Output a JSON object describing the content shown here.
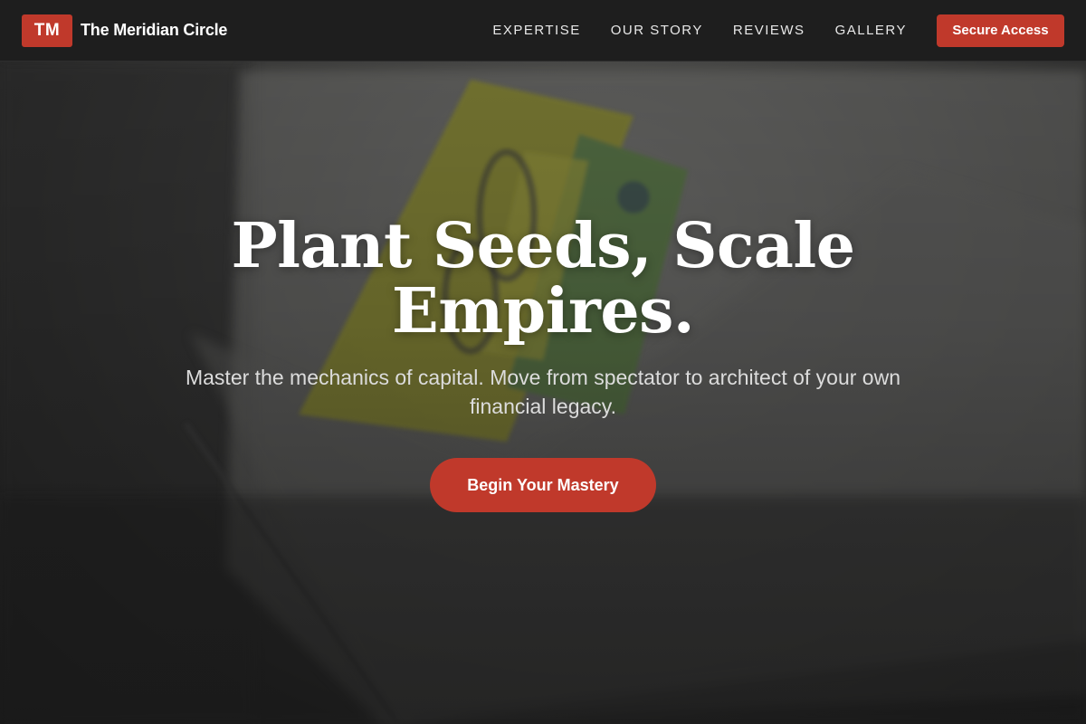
{
  "brand": {
    "logo_text": "TM",
    "name": "The Meridian Circle"
  },
  "nav": {
    "items": [
      {
        "label": "EXPERTISE"
      },
      {
        "label": "OUR STORY"
      },
      {
        "label": "REVIEWS"
      },
      {
        "label": "GALLERY"
      }
    ],
    "cta_label": "Secure Access"
  },
  "hero": {
    "title_line1": "Plant Seeds, Scale",
    "title_line2": "Empires.",
    "subtitle": "Master the mechanics of capital. Move from spectator to architect of your own financial legacy.",
    "cta_label": "Begin Your Mastery",
    "background_image": "cash-in-envelope-photo"
  },
  "colors": {
    "accent": "#c0392b",
    "header_bg": "#1e1e1e",
    "hero_text": "#ffffff",
    "subtitle_text": "#dcdcdc"
  }
}
